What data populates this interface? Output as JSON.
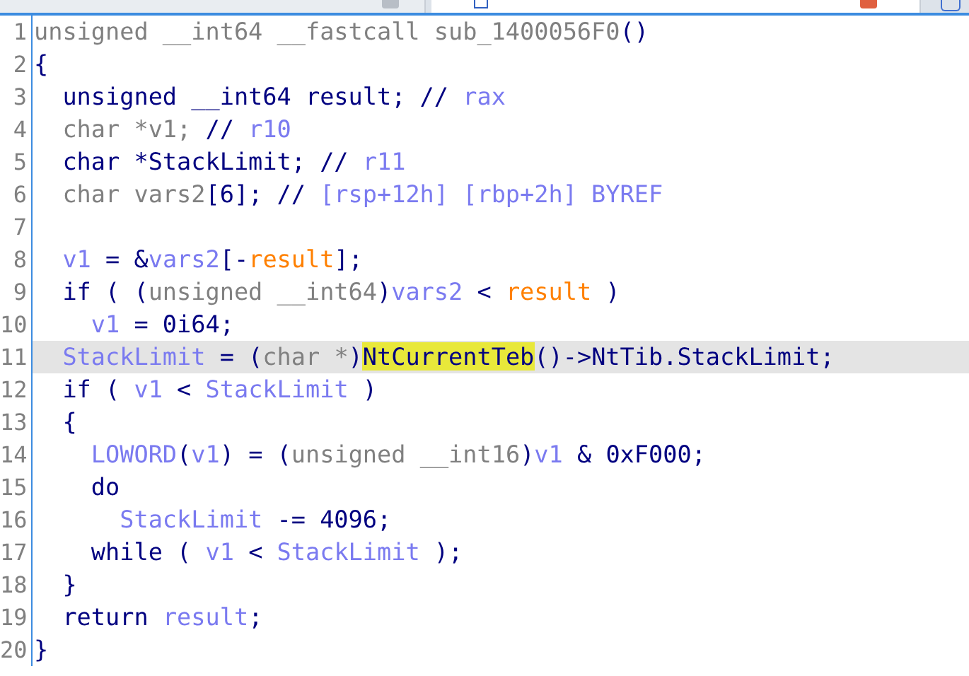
{
  "tabs": [
    {
      "selected": false
    },
    {
      "selected": true
    }
  ],
  "code": {
    "lines": [
      {
        "number": "1",
        "selected": false,
        "tokens": [
          {
            "text": "unsigned __int64 __fastcall sub_1400056F0",
            "kind": "type"
          },
          {
            "text": "()",
            "kind": "plain"
          }
        ]
      },
      {
        "number": "2",
        "selected": false,
        "tokens": [
          {
            "text": "{",
            "kind": "plain"
          }
        ]
      },
      {
        "number": "3",
        "selected": false,
        "tokens": [
          {
            "text": "  unsigned __int64 result; // ",
            "kind": "plain"
          },
          {
            "text": "rax",
            "kind": "var"
          }
        ]
      },
      {
        "number": "4",
        "selected": false,
        "tokens": [
          {
            "text": "  char *v1; ",
            "kind": "type"
          },
          {
            "text": "// ",
            "kind": "plain"
          },
          {
            "text": "r10",
            "kind": "var"
          }
        ]
      },
      {
        "number": "5",
        "selected": false,
        "tokens": [
          {
            "text": "  char *StackLimit; // ",
            "kind": "plain"
          },
          {
            "text": "r11",
            "kind": "var"
          }
        ]
      },
      {
        "number": "6",
        "selected": false,
        "tokens": [
          {
            "text": "  char vars2",
            "kind": "type"
          },
          {
            "text": "[6]; // ",
            "kind": "plain"
          },
          {
            "text": "[rsp+12h] [rbp+2h] BYREF",
            "kind": "var"
          }
        ]
      },
      {
        "number": "7",
        "selected": false
      },
      {
        "number": "8",
        "selected": false,
        "tokens": [
          {
            "text": "  v1",
            "kind": "var"
          },
          {
            "text": " = &",
            "kind": "plain"
          },
          {
            "text": "vars2",
            "kind": "var"
          },
          {
            "text": "[-",
            "kind": "plain"
          },
          {
            "text": "result",
            "kind": "global"
          },
          {
            "text": "];",
            "kind": "plain"
          }
        ]
      },
      {
        "number": "9",
        "selected": false,
        "tokens": [
          {
            "text": "  if ( (",
            "kind": "plain"
          },
          {
            "text": "unsigned __int64",
            "kind": "type"
          },
          {
            "text": ")",
            "kind": "plain"
          },
          {
            "text": "vars2",
            "kind": "var"
          },
          {
            "text": " < ",
            "kind": "plain"
          },
          {
            "text": "result",
            "kind": "global"
          },
          {
            "text": " )",
            "kind": "plain"
          }
        ]
      },
      {
        "number": "10",
        "selected": false,
        "tokens": [
          {
            "text": "    v1",
            "kind": "var"
          },
          {
            "text": " = 0i64;",
            "kind": "plain"
          }
        ]
      },
      {
        "number": "11",
        "selected": true,
        "tokens": [
          {
            "text": "  StackLimit",
            "kind": "var"
          },
          {
            "text": " = (",
            "kind": "plain"
          },
          {
            "text": "char *",
            "kind": "type"
          },
          {
            "text": ")",
            "kind": "plain"
          },
          {
            "text": "NtCurrentTeb",
            "kind": "match"
          },
          {
            "text": "()->NtTib.StackLimit;",
            "kind": "plain"
          }
        ]
      },
      {
        "number": "12",
        "selected": false,
        "tokens": [
          {
            "text": "  if ( ",
            "kind": "plain"
          },
          {
            "text": "v1",
            "kind": "var"
          },
          {
            "text": " < ",
            "kind": "plain"
          },
          {
            "text": "StackLimit",
            "kind": "var"
          },
          {
            "text": " )",
            "kind": "plain"
          }
        ]
      },
      {
        "number": "13",
        "selected": false,
        "tokens": [
          {
            "text": "  {",
            "kind": "plain"
          }
        ]
      },
      {
        "number": "14",
        "selected": false,
        "tokens": [
          {
            "text": "    LOWORD",
            "kind": "var"
          },
          {
            "text": "(",
            "kind": "plain"
          },
          {
            "text": "v1",
            "kind": "var"
          },
          {
            "text": ") = (",
            "kind": "plain"
          },
          {
            "text": "unsigned __int16",
            "kind": "type"
          },
          {
            "text": ")",
            "kind": "plain"
          },
          {
            "text": "v1",
            "kind": "var"
          },
          {
            "text": " & 0xF000;",
            "kind": "plain"
          }
        ]
      },
      {
        "number": "15",
        "selected": false,
        "tokens": [
          {
            "text": "    do",
            "kind": "plain"
          }
        ]
      },
      {
        "number": "16",
        "selected": false,
        "tokens": [
          {
            "text": "      StackLimit",
            "kind": "var"
          },
          {
            "text": " -= 4096;",
            "kind": "plain"
          }
        ]
      },
      {
        "number": "17",
        "selected": false,
        "tokens": [
          {
            "text": "    while ( ",
            "kind": "plain"
          },
          {
            "text": "v1",
            "kind": "var"
          },
          {
            "text": " < ",
            "kind": "plain"
          },
          {
            "text": "StackLimit",
            "kind": "var"
          },
          {
            "text": " );",
            "kind": "plain"
          }
        ]
      },
      {
        "number": "18",
        "selected": false,
        "tokens": [
          {
            "text": "  }",
            "kind": "plain"
          }
        ]
      },
      {
        "number": "19",
        "selected": false,
        "tokens": [
          {
            "text": "  return ",
            "kind": "plain"
          },
          {
            "text": "result",
            "kind": "var"
          },
          {
            "text": ";",
            "kind": "plain"
          }
        ]
      },
      {
        "number": "20",
        "selected": false,
        "tokens": [
          {
            "text": "}",
            "kind": "plain"
          }
        ]
      }
    ]
  }
}
